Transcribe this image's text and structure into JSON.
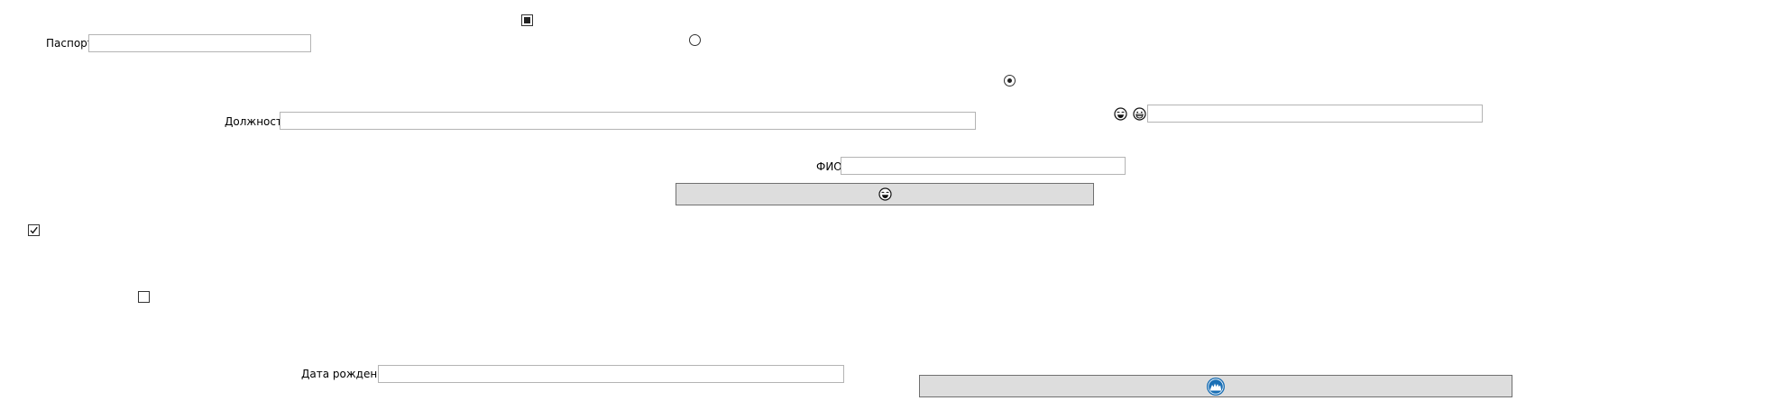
{
  "form": {
    "passport_label": "Паспорт",
    "position_label": "Должность",
    "fio_label": "ФИО",
    "birthdate_label": "Дата рождения"
  },
  "fields": {
    "passport_value": "",
    "position_value": "",
    "fio_value": "",
    "birthdate_value": "",
    "emoji_field_value": ""
  },
  "controls": {
    "checkbox_top_state": "indeterminate",
    "checkbox_left_state": "checked",
    "checkbox_lower_state": "unchecked",
    "radio_top_state": "unchecked",
    "radio_right_state": "checked"
  },
  "icons": {
    "emoji_a": "laughing-face-icon",
    "emoji_b": "grinning-face-icon",
    "button_center_icon": "laughing-face-icon",
    "button_bottom_icon": "crowd-badge-icon"
  },
  "colors": {
    "button_bg": "#dddddd",
    "field_border": "#b4b4b4",
    "badge_blue": "#1a6fb5"
  }
}
